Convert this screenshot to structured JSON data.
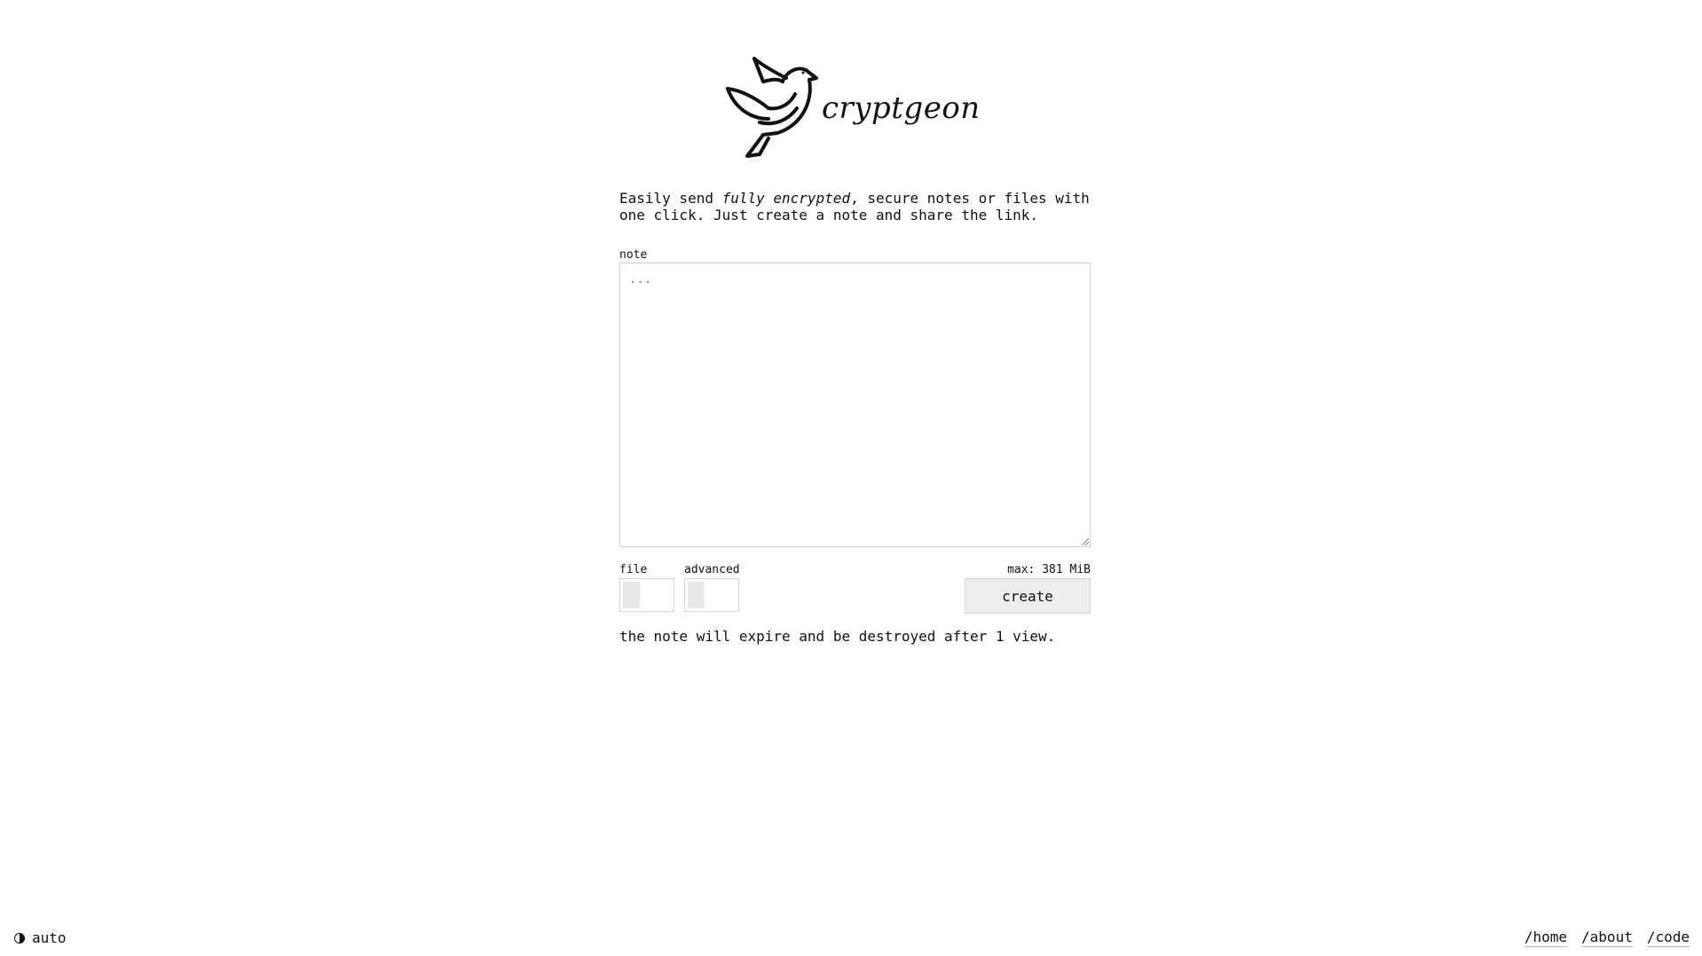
{
  "brand": {
    "name": "cryptgeon",
    "logo_icon": "dove-logo-icon"
  },
  "intro": {
    "prefix": "Easily send ",
    "emphasis": "fully encrypted",
    "suffix": ", secure notes or files with one click. Just create a note and share the link."
  },
  "form": {
    "note_label": "note",
    "note_placeholder": "...",
    "note_value": "",
    "file_label": "file",
    "advanced_label": "advanced",
    "max_label": "max: 381 MiB",
    "create_label": "create",
    "expire_text": "the note will expire and be destroyed after 1 view."
  },
  "footer": {
    "theme_icon": "contrast-icon",
    "theme_label": "auto",
    "links": {
      "home": "/home",
      "about": "/about",
      "code": "/code"
    }
  }
}
